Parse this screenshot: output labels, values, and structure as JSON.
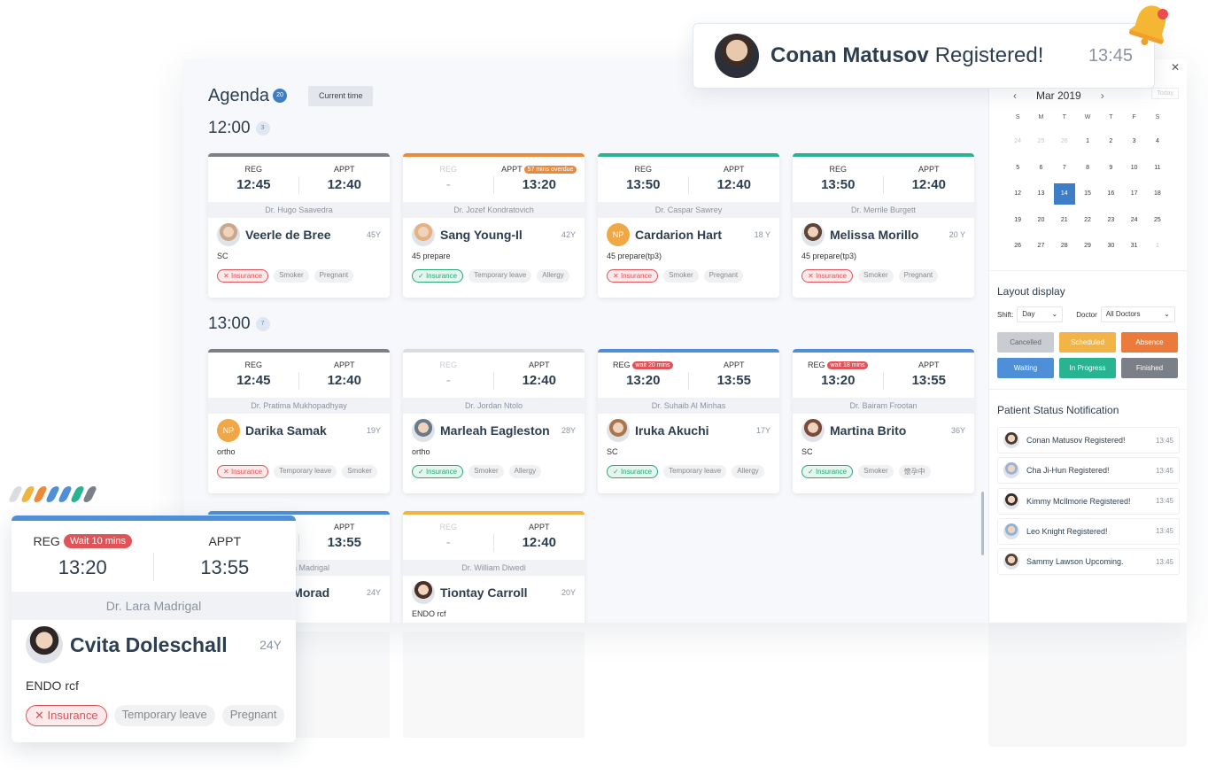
{
  "toast": {
    "name": "Conan Matusov",
    "message": "Registered!",
    "time": "13:45",
    "avatar_icon": "user-avatar"
  },
  "agenda": {
    "title": "Agenda",
    "count": "20",
    "current_time_label": "Current time"
  },
  "slots": [
    {
      "time": "12:00",
      "count": "3",
      "cards": [
        {
          "color": "#7b7f87",
          "reg_label": "REG",
          "reg": "12:45",
          "reg_badge": "",
          "appt_label": "APPT",
          "appt": "12:40",
          "appt_badge": "",
          "doctor": "Dr. Hugo Saavedra",
          "name": "Veerle de Bree",
          "age": "45Y",
          "note": "SC",
          "avatar": "#c9a98d",
          "tags": [
            {
              "text": "Insurance",
              "kind": "no"
            },
            {
              "text": "Smoker",
              "kind": "plain"
            },
            {
              "text": "Pregnant",
              "kind": "plain"
            }
          ]
        },
        {
          "color": "#ec8a3a",
          "reg_label": "REG",
          "reg": "-",
          "reg_badge": "",
          "appt_label": "APPT",
          "appt": "13:20",
          "appt_badge": "57 mins overdue",
          "doctor": "Dr. Jozef Kondratovich",
          "name": "Sang Young-Il",
          "age": "42Y",
          "note": "45 prepare",
          "avatar": "#e3b27e",
          "tags": [
            {
              "text": "Insurance",
              "kind": "ok"
            },
            {
              "text": "Temporary leave",
              "kind": "plain"
            },
            {
              "text": "Allergy",
              "kind": "plain"
            }
          ]
        },
        {
          "color": "#28b391",
          "reg_label": "REG",
          "reg": "13:50",
          "reg_badge": "",
          "appt_label": "APPT",
          "appt": "12:40",
          "appt_badge": "",
          "doctor": "Dr. Caspar Sawrey",
          "name": "Cardarion Hart",
          "age": "18 Y",
          "note": "45 prepare(tp3)",
          "avatar": "#f0a745",
          "initials": "NP",
          "tags": [
            {
              "text": "Insurance",
              "kind": "no"
            },
            {
              "text": "Smoker",
              "kind": "plain"
            },
            {
              "text": "Pregnant",
              "kind": "plain"
            }
          ]
        },
        {
          "color": "#28b391",
          "reg_label": "REG",
          "reg": "13:50",
          "reg_badge": "",
          "appt_label": "APPT",
          "appt": "12:40",
          "appt_badge": "",
          "doctor": "Dr. Merrile Burgett",
          "name": "Melissa Morillo",
          "age": "20 Y",
          "note": "45 prepare(tp3)",
          "avatar": "#5c4636",
          "tags": [
            {
              "text": "Insurance",
              "kind": "no"
            },
            {
              "text": "Smoker",
              "kind": "plain"
            },
            {
              "text": "Pregnant",
              "kind": "plain"
            }
          ]
        }
      ]
    },
    {
      "time": "13:00",
      "count": "7",
      "cards": [
        {
          "color": "#7b7f87",
          "reg_label": "REG",
          "reg": "12:45",
          "reg_badge": "",
          "appt_label": "APPT",
          "appt": "12:40",
          "appt_badge": "",
          "doctor": "Dr. Pratima Mukhopadhyay",
          "name": "Darika Samak",
          "age": "19Y",
          "note": "ortho",
          "avatar": "#f0a745",
          "initials": "NP",
          "tags": [
            {
              "text": "Insurance",
              "kind": "no"
            },
            {
              "text": "Temporary leave",
              "kind": "plain"
            },
            {
              "text": "Smoker",
              "kind": "plain"
            }
          ]
        },
        {
          "color": "#d9dce1",
          "reg_label": "REG",
          "reg": "-",
          "reg_badge": "",
          "appt_label": "APPT",
          "appt": "12:40",
          "appt_badge": "",
          "doctor": "Dr. Jordan Ntolo",
          "name": "Marleah Eagleston",
          "age": "28Y",
          "note": "ortho",
          "avatar": "#6b7a88",
          "tags": [
            {
              "text": "Insurance",
              "kind": "ok"
            },
            {
              "text": "Smoker",
              "kind": "plain"
            },
            {
              "text": "Allergy",
              "kind": "plain"
            }
          ]
        },
        {
          "color": "#4f8fd8",
          "reg_label": "REG",
          "reg": "13:20",
          "reg_badge": "wait 20 mins",
          "appt_label": "APPT",
          "appt": "13:55",
          "appt_badge": "",
          "doctor": "Dr. Suhaib Al Minhas",
          "name": "Iruka Akuchi",
          "age": "17Y",
          "note": "SC",
          "avatar": "#a9764d",
          "tags": [
            {
              "text": "Insurance",
              "kind": "ok"
            },
            {
              "text": "Temporary leave",
              "kind": "plain"
            },
            {
              "text": "Allergy",
              "kind": "plain"
            }
          ]
        },
        {
          "color": "#4f8fd8",
          "reg_label": "REG",
          "reg": "13:20",
          "reg_badge": "wait 18 mins",
          "appt_label": "APPT",
          "appt": "13:55",
          "appt_badge": "",
          "doctor": "Dr. Bairam Frootan",
          "name": "Martina Brito",
          "age": "36Y",
          "note": "SC",
          "avatar": "#7a4a3a",
          "tags": [
            {
              "text": "Insurance",
              "kind": "ok"
            },
            {
              "text": "Smoker",
              "kind": "plain"
            },
            {
              "text": "懷孕中",
              "kind": "plain"
            }
          ]
        }
      ]
    },
    {
      "time": "",
      "count": "",
      "cards": [
        {
          "color": "#4f8fd8",
          "reg_label": "REG",
          "reg": "13:20",
          "reg_badge": "",
          "appt_label": "APPT",
          "appt": "13:55",
          "appt_badge": "",
          "doctor": "Dr. Lara Madrigal",
          "name": "Leila Al Morad",
          "age": "24Y",
          "note": "",
          "avatar": "#3b2c28",
          "tags": []
        },
        {
          "color": "#f0b441",
          "reg_label": "REG",
          "reg": "-",
          "reg_badge": "",
          "appt_label": "APPT",
          "appt": "12:40",
          "appt_badge": "",
          "doctor": "Dr. William Diwedi",
          "name": "Tiontay Carroll",
          "age": "20Y",
          "note": "ENDO rcf",
          "avatar": "#4a3026",
          "tags": []
        }
      ]
    }
  ],
  "calendar": {
    "month": "Mar 2019",
    "today_label": "Today",
    "weekdays": [
      "S",
      "M",
      "T",
      "W",
      "T",
      "F",
      "S"
    ],
    "days": [
      {
        "d": "24",
        "m": true
      },
      {
        "d": "25",
        "m": true
      },
      {
        "d": "26",
        "m": true
      },
      {
        "d": "1"
      },
      {
        "d": "2"
      },
      {
        "d": "3"
      },
      {
        "d": "4"
      },
      {
        "d": "5"
      },
      {
        "d": "6"
      },
      {
        "d": "7"
      },
      {
        "d": "8"
      },
      {
        "d": "9"
      },
      {
        "d": "10"
      },
      {
        "d": "11"
      },
      {
        "d": "12"
      },
      {
        "d": "13"
      },
      {
        "d": "14",
        "sel": true
      },
      {
        "d": "15"
      },
      {
        "d": "16"
      },
      {
        "d": "17"
      },
      {
        "d": "18"
      },
      {
        "d": "19"
      },
      {
        "d": "20"
      },
      {
        "d": "21"
      },
      {
        "d": "22"
      },
      {
        "d": "23"
      },
      {
        "d": "24"
      },
      {
        "d": "25"
      },
      {
        "d": "26"
      },
      {
        "d": "27"
      },
      {
        "d": "28"
      },
      {
        "d": "29"
      },
      {
        "d": "30"
      },
      {
        "d": "31"
      },
      {
        "d": "1",
        "m": true
      }
    ]
  },
  "layout": {
    "title": "Layout display",
    "shift_label": "Shift:",
    "shift_value": "Day",
    "doctor_label": "Doctor",
    "doctor_value": "All Doctors",
    "statuses": [
      {
        "label": "Cancelled",
        "color": "#c9ccd2",
        "text": "#666"
      },
      {
        "label": "Scheduled",
        "color": "#f2b347",
        "text": "#fff"
      },
      {
        "label": "Absence",
        "color": "#ec7a3d",
        "text": "#fff"
      },
      {
        "label": "Waiting",
        "color": "#4f8fd8",
        "text": "#fff"
      },
      {
        "label": "In Progress",
        "color": "#28b391",
        "text": "#fff"
      },
      {
        "label": "Finished",
        "color": "#7b7f87",
        "text": "#fff"
      }
    ]
  },
  "notifications": {
    "title": "Patient Status Notification",
    "items": [
      {
        "text": "Conan Matusov Registered!",
        "time": "13:45",
        "avatar": "#4a3b33"
      },
      {
        "text": "Cha Ji-Hun Registered!",
        "time": "13:45",
        "avatar": "#9ab3d6"
      },
      {
        "text": "Kimmy McIlmorie Registered!",
        "time": "13:45",
        "avatar": "#3a2c28"
      },
      {
        "text": "Leo Knight Registered!",
        "time": "13:45",
        "avatar": "#8eb2d8"
      },
      {
        "text": "Sammy Lawson Upcoming.",
        "time": "13:45",
        "avatar": "#55433a"
      }
    ]
  },
  "zoom_card": {
    "color": "#4f8fd8",
    "reg_label": "REG",
    "reg_badge": "Wait 10 mins",
    "reg": "13:20",
    "appt_label": "APPT",
    "appt": "13:55",
    "doctor": "Dr. Lara Madrigal",
    "name": "Cvita Doleschall",
    "age": "24Y",
    "note": "ENDO rcf",
    "avatar": "#2e2624",
    "tags": [
      {
        "text": "Insurance",
        "kind": "no"
      },
      {
        "text": "Temporary leave",
        "kind": "plain"
      },
      {
        "text": "Pregnant",
        "kind": "plain"
      }
    ]
  },
  "color_dots": [
    "#d9dce1",
    "#f0b441",
    "#ec8a3a",
    "#4f8fd8",
    "#4f8fd8",
    "#28b391",
    "#7b7f87"
  ]
}
